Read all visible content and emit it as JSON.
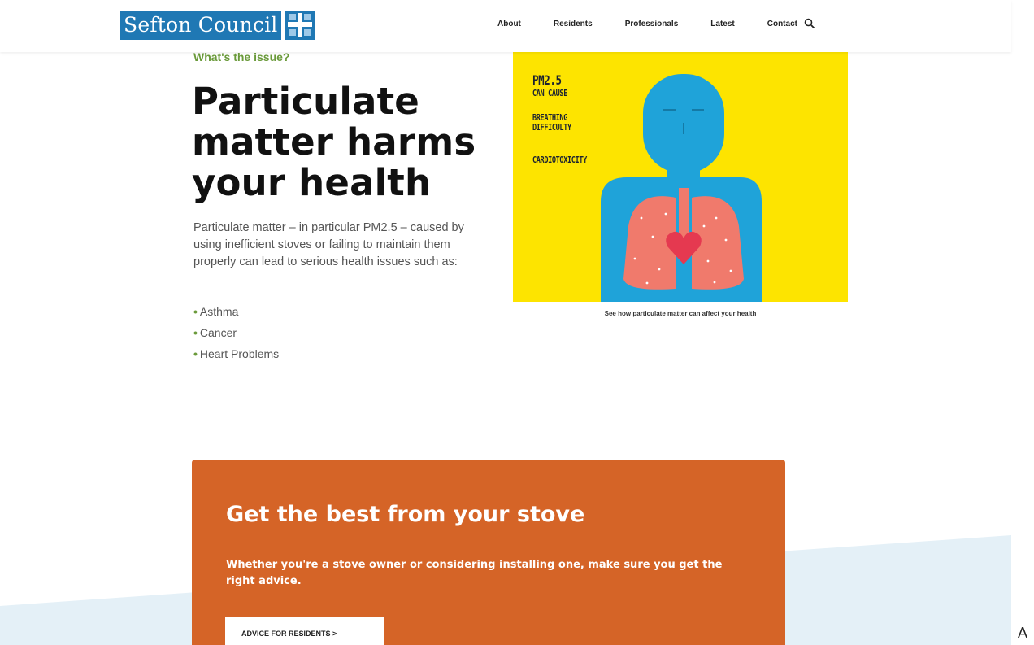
{
  "header": {
    "logo_text": "Sefton Council",
    "nav": [
      "About",
      "Residents",
      "Professionals",
      "Latest",
      "Contact"
    ],
    "search_icon": "search-icon"
  },
  "main": {
    "eyebrow": "What's the issue?",
    "headline": "Particulate matter harms your health",
    "body": "Particulate matter – in particular PM2.5 – caused by using inefficient stoves or failing to maintain them properly can lead to serious health issues such as:",
    "bullets": [
      "Asthma",
      "Cancer",
      "Heart Problems"
    ]
  },
  "illustration": {
    "line1": "PM2.5",
    "line2": "CAN CAUSE",
    "line3": "BREATHING",
    "line4": "DIFFICULTY",
    "line5": "CARDIOTOXICITY",
    "caption": "See how particulate matter can affect your health"
  },
  "promo": {
    "title": "Get the best from your stove",
    "text": "Whether you're a stove owner or considering installing one, make sure you get the right advice.",
    "button": "ADVICE FOR RESIDENTS >"
  },
  "side_letter": "A",
  "colors": {
    "brand_blue": "#1f78b4",
    "accent_green": "#6a9a3a",
    "promo_orange": "#d56427",
    "illustration_yellow": "#fde400",
    "wave_blue": "#e4f0f7"
  }
}
